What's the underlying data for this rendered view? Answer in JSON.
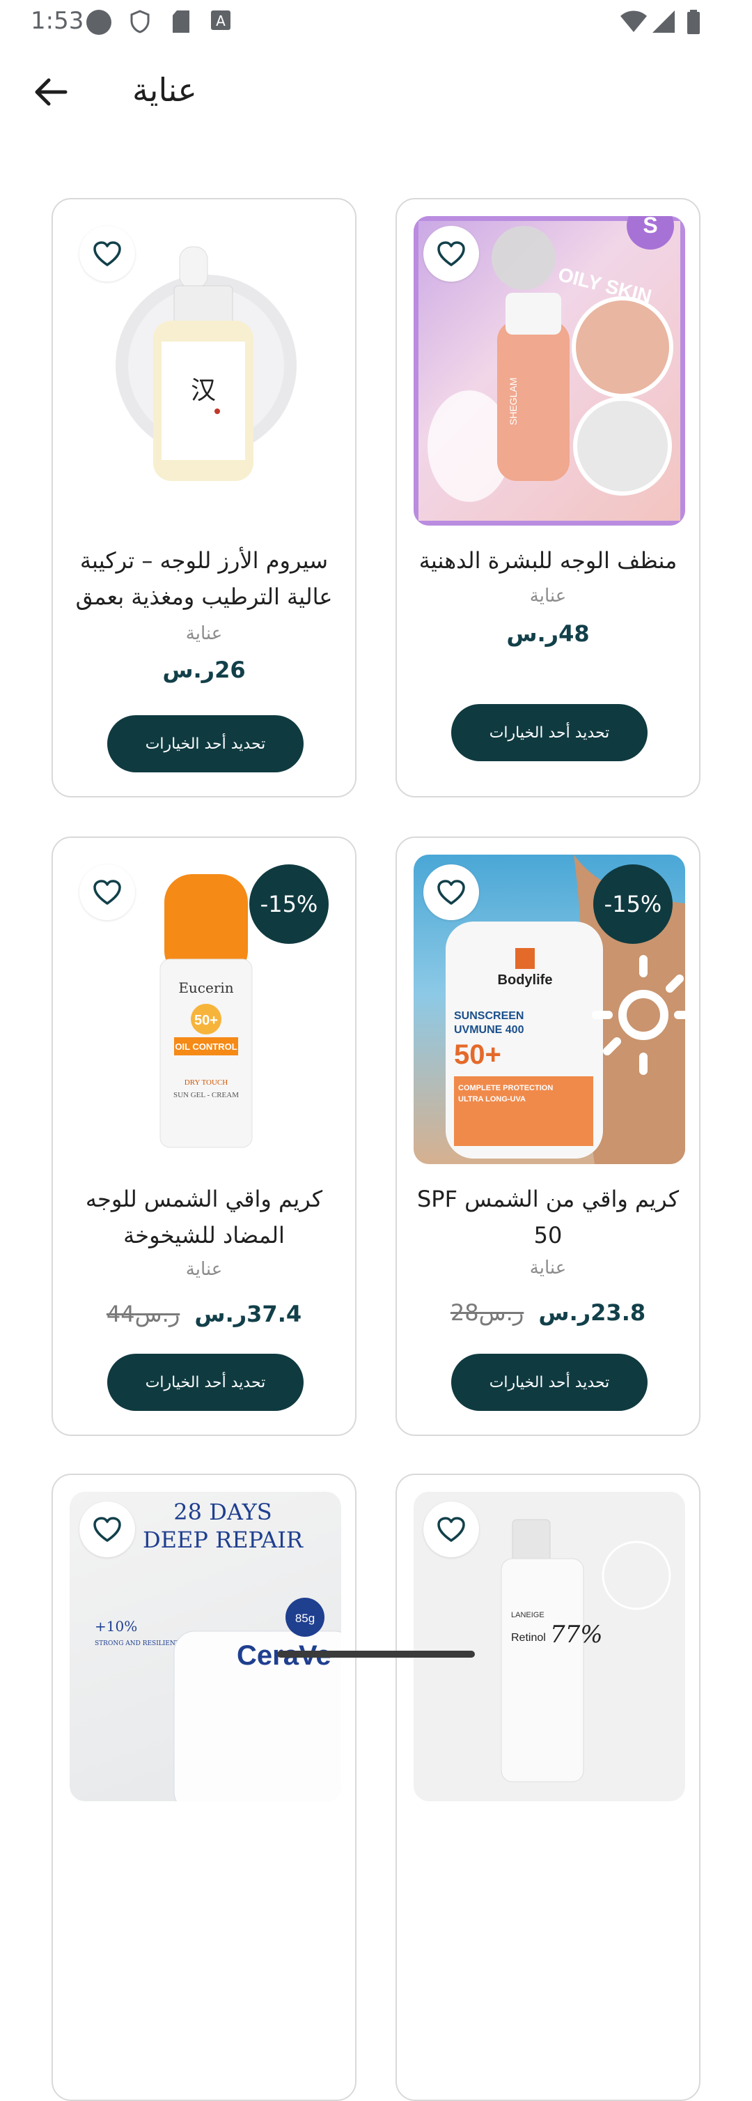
{
  "status_bar": {
    "time": "1:53"
  },
  "app_bar": {
    "title": "عناية"
  },
  "products": [
    {
      "name": "منظف الوجه للبشرة الدهنية",
      "brand": "عناية",
      "price": "48ر.س",
      "old_price": "",
      "discount": "",
      "button_label": "تحديد أحد الخيارات",
      "image_text": [
        "OILY SKIN",
        "SHEGLAM"
      ]
    },
    {
      "name": "سيروم الأرز للوجه – تركيبة عالية الترطيب ومغذية بعمق",
      "brand": "عناية",
      "price": "26ر.س",
      "old_price": "",
      "discount": "",
      "button_label": "تحديد أحد الخيارات",
      "image_text": []
    },
    {
      "name": "كريم واقي من الشمس SPF 50",
      "brand": "عناية",
      "price": "23.8ر.س",
      "old_price": "28ر.س",
      "discount": "-15%",
      "button_label": "تحديد أحد الخيارات",
      "image_text": [
        "Bodylife",
        "SUNSCREEN",
        "UVMUNE 400",
        "50+",
        "COMPLETE PROTECTION",
        "ULTRA LONG-UVA"
      ]
    },
    {
      "name": "كريم واقي الشمس للوجه المضاد للشيخوخة",
      "brand": "عناية",
      "price": "37.4ر.س",
      "old_price": "44ر.س",
      "discount": "-15%",
      "button_label": "تحديد أحد الخيارات",
      "image_text": [
        "Eucerin",
        "50+",
        "OIL CONTROL",
        "DRY TOUCH",
        "SUN GEL - CREAM"
      ]
    },
    {
      "name": "",
      "image_text": [
        "LANEIGE",
        "Retinol",
        "77%"
      ]
    },
    {
      "name": "",
      "image_text": [
        "28 DAYS",
        "DEEP REPAIR",
        "+10%",
        "STRONG AND RESILIENT BARRIER",
        "85g",
        "CeraVe"
      ]
    }
  ],
  "colors": {
    "primary": "#0f3a40",
    "card_border": "#d9d9d9",
    "muted_text": "#8c8c8c"
  }
}
